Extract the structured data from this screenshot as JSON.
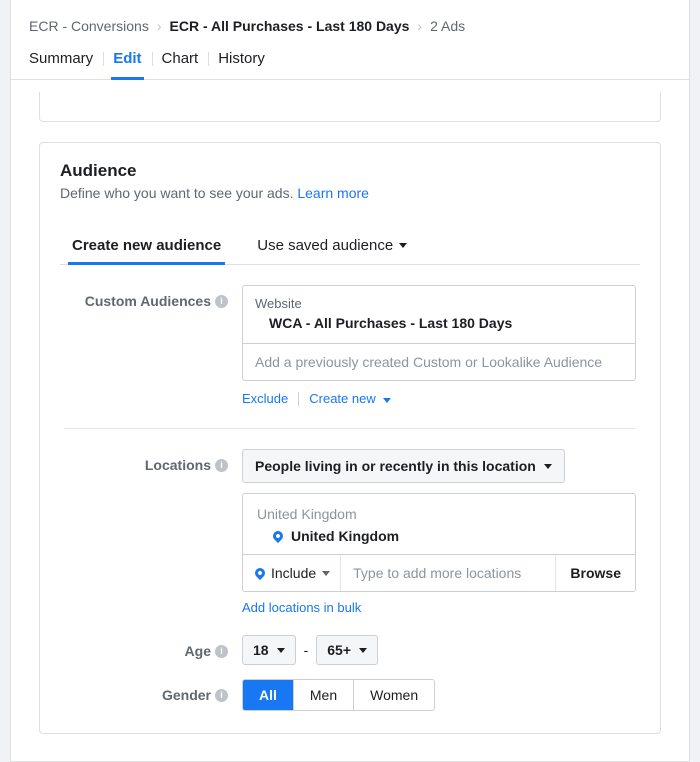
{
  "breadcrumb": {
    "item1": "ECR - Conversions",
    "item2": "ECR - All Purchases - Last 180 Days",
    "item3": "2 Ads"
  },
  "tabs": {
    "summary": "Summary",
    "edit": "Edit",
    "chart": "Chart",
    "history": "History"
  },
  "audience": {
    "title": "Audience",
    "subtitle": "Define who you want to see your ads. ",
    "learn_more": "Learn more",
    "tab_create": "Create new audience",
    "tab_saved": "Use saved audience",
    "custom_label": "Custom Audiences",
    "ca_category": "Website",
    "ca_name": "WCA - All Purchases - Last 180 Days",
    "ca_placeholder": "Add a previously created Custom or Lookalike Audience",
    "exclude": "Exclude",
    "create_new": "Create new",
    "locations_label": "Locations",
    "loc_select": "People living in or recently in this location",
    "loc_country_group": "United Kingdom",
    "loc_country": "United Kingdom",
    "include": "Include",
    "loc_placeholder": "Type to add more locations",
    "browse": "Browse",
    "bulk": "Add locations in bulk",
    "age_label": "Age",
    "age_min": "18",
    "age_max": "65+",
    "age_sep": "-",
    "gender_label": "Gender",
    "gender_all": "All",
    "gender_men": "Men",
    "gender_women": "Women"
  }
}
